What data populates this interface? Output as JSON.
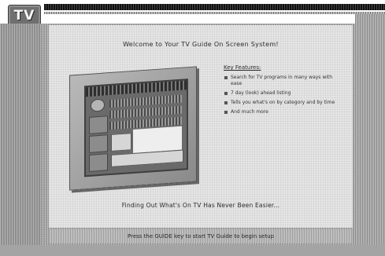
{
  "header": {
    "logo_text": "TV",
    "logo_icon": "tv-guide-logo-icon"
  },
  "main": {
    "welcome_text": "Welcome to Your TV Guide On Screen System!",
    "features_title": "Key Features:",
    "features": [
      "Search for TV programs in many ways with ease",
      "7 day (look) ahead listing",
      "Tells you what's on by category and by time",
      "And much more"
    ],
    "finding_text": "Finding Out What's On TV Has Never Been Easier..."
  },
  "footer": {
    "prompt_text": "Press the GUIDE key to start TV Guide to begin setup"
  },
  "colors": {
    "panel": "#e6e6e6",
    "background": "#9c9c9c",
    "logo": "#6f6f6f"
  }
}
